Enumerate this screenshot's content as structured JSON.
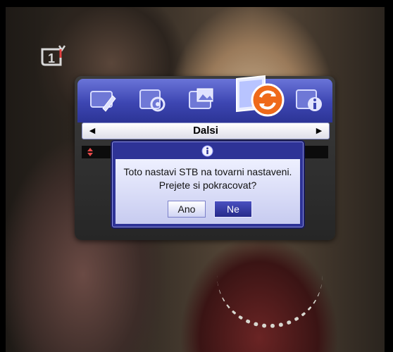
{
  "channel": {
    "logo_label": "1",
    "icon": "ct1-channel-logo"
  },
  "menu": {
    "tabs": [
      {
        "icon": "picture-settings-icon"
      },
      {
        "icon": "system-settings-icon"
      },
      {
        "icon": "media-settings-icon"
      },
      {
        "icon": "factory-reset-icon",
        "active": true
      },
      {
        "icon": "info-icon"
      }
    ],
    "nav_left_glyph": "◀",
    "nav_right_glyph": "▶",
    "section_title": "Dalsi"
  },
  "dialog": {
    "icon": "info-icon",
    "message_line1": "Toto nastavi STB na tovarni nastaveni.",
    "message_line2": "Prejete si pokracovat?",
    "yes_label": "Ano",
    "no_label": "Ne",
    "selected": "Ne"
  },
  "colors": {
    "icon_bar": "#3d46b2",
    "dialog_bg": "#2e3396",
    "highlight_orange": "#ef6a1a"
  }
}
